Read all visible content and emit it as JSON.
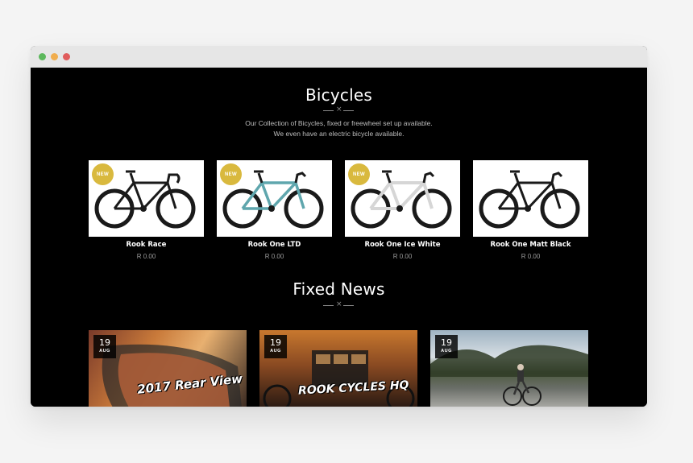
{
  "browser": {
    "dots": [
      "green",
      "yellow",
      "red"
    ]
  },
  "bicycles": {
    "title": "Bicycles",
    "divider_symbol": "×",
    "subtitle_line1": "Our Collection of Bicycles, fixed or freewheel set up available.",
    "subtitle_line2": "We even have an electric bicycle available.",
    "products": [
      {
        "name": "Rook Race",
        "price": "R 0.00",
        "badge": "NEW",
        "frame_color": "#1a1a1a"
      },
      {
        "name": "Rook One LTD",
        "price": "R 0.00",
        "badge": "NEW",
        "frame_color": "#5fa6ad"
      },
      {
        "name": "Rook One Ice White",
        "price": "R 0.00",
        "badge": "NEW",
        "frame_color": "#eeeeee"
      },
      {
        "name": "Rook One Matt Black",
        "price": "R 0.00",
        "badge": "",
        "frame_color": "#1a1a1a"
      }
    ]
  },
  "news": {
    "title": "Fixed News",
    "divider_symbol": "×",
    "posts": [
      {
        "day": "19",
        "month": "AUG",
        "image_text": "2017 Rear View"
      },
      {
        "day": "19",
        "month": "AUG",
        "image_text": "ROOK CYCLES HQ"
      },
      {
        "day": "19",
        "month": "AUG",
        "image_text": ""
      }
    ]
  },
  "colors": {
    "badge": "#d9b93e",
    "page_bg": "#000000"
  }
}
